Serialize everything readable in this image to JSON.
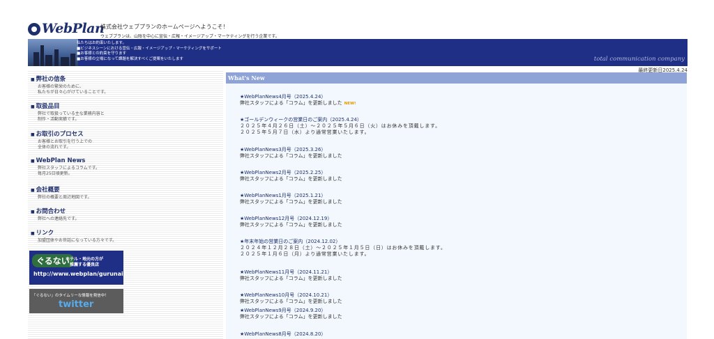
{
  "header": {
    "logo_text": "WebPlan",
    "company_line": "株式会社ウェブプランのホームページへようこそ！",
    "intro_line": "ウェブプランは、山陰を中心に宣伝・広報・イメージアップ・マーケティングを行う企業です。",
    "banner_lines": [
      "私たちはお約束いたします。",
      "■ビジネスシーンにおける宣伝・広報・イメージアップ・マーケティングをサポート",
      "■お客様との約束を守ります",
      "■お客様の立場になって課題を解決すべくご提案をいたします"
    ],
    "tagline": "total communication company",
    "update_date": "最終更新日2025.4.24"
  },
  "sidebar": {
    "items": [
      {
        "title": "弊社の信条",
        "desc": [
          "お客様の繁栄のために、",
          "私たちが日々心がけていることです。"
        ]
      },
      {
        "title": "取扱品目",
        "desc": [
          "弊社で取扱っている主な業務内容と",
          "制作・活動実績です。"
        ]
      },
      {
        "title": "お取引のプロセス",
        "desc": [
          "お客様とお取引を行う上での",
          "全体の流れです。"
        ]
      },
      {
        "title": "WebPlan News",
        "desc": [
          "弊社スタッフによるコラムです。",
          "毎月25日頃更新。"
        ]
      },
      {
        "title": "会社概要",
        "desc": [
          "弊社の概要と周辺地図です。"
        ]
      },
      {
        "title": "お問合わせ",
        "desc": [
          "弊社への連絡先です。"
        ]
      },
      {
        "title": "リンク",
        "desc": [
          "加盟団体やお世話になっている方々です。"
        ]
      }
    ],
    "gurunai": {
      "logo": "ぐるない",
      "sub1": "ホテル・地元の方が",
      "sub2": "推薦する優良店",
      "url": "http://www.webplan/gurunai/"
    },
    "twitter": {
      "line": "「ぐるない」のタイムリーな情報を発信中！",
      "logo": "twitter"
    }
  },
  "main": {
    "header_label": "What's New",
    "news": [
      {
        "title": "★WebPlanNews4月号（2025.4.24）",
        "detail": "弊社スタッフによる「コラム」を更新しました",
        "badge": "NEW!"
      },
      {
        "title": "★ゴールデンウィークの営業日のご案内（2025.4.24）",
        "wide": [
          "２０２５年４月２６日（土）～２０２５年５月６日（火）はお休みを頂戴します。",
          "２０２５年５月７日（水）より通常営業いたします。"
        ]
      },
      {
        "title": "★WebPlanNews3月号（2025.3.26）",
        "detail": "弊社スタッフによる「コラム」を更新しました"
      },
      {
        "title": "★WebPlanNews2月号（2025.2.25）",
        "detail": "弊社スタッフによる「コラム」を更新しました"
      },
      {
        "title": "★WebPlanNews1月号（2025.1.21）",
        "detail": "弊社スタッフによる「コラム」を更新しました"
      },
      {
        "title": "★WebPlanNews12月号（2024.12.19）",
        "detail": "弊社スタッフによる「コラム」を更新しました"
      },
      {
        "title": "★年末年始の営業日のご案内（2024.12.02）",
        "wide": [
          "２０２４年１２月２８日（土）～２０２５年１月５日（日）はお休みを頂戴します。",
          "２０２５年１月６日（月）より通常営業いたします。"
        ]
      },
      {
        "title": "★WebPlanNews11月号（2024.11.21）",
        "detail": "弊社スタッフによる「コラム」を更新しました"
      },
      {
        "title": "★WebPlanNews10月号（2024.10.21）",
        "detail": "弊社スタッフによる「コラム」を更新しました"
      },
      {
        "title": "★WebPlanNews9月号（2024.9.20）",
        "detail": "弊社スタッフによる「コラム」を更新しました"
      },
      {
        "title": "★WebPlanNews8月号（2024.8.20）"
      }
    ]
  }
}
